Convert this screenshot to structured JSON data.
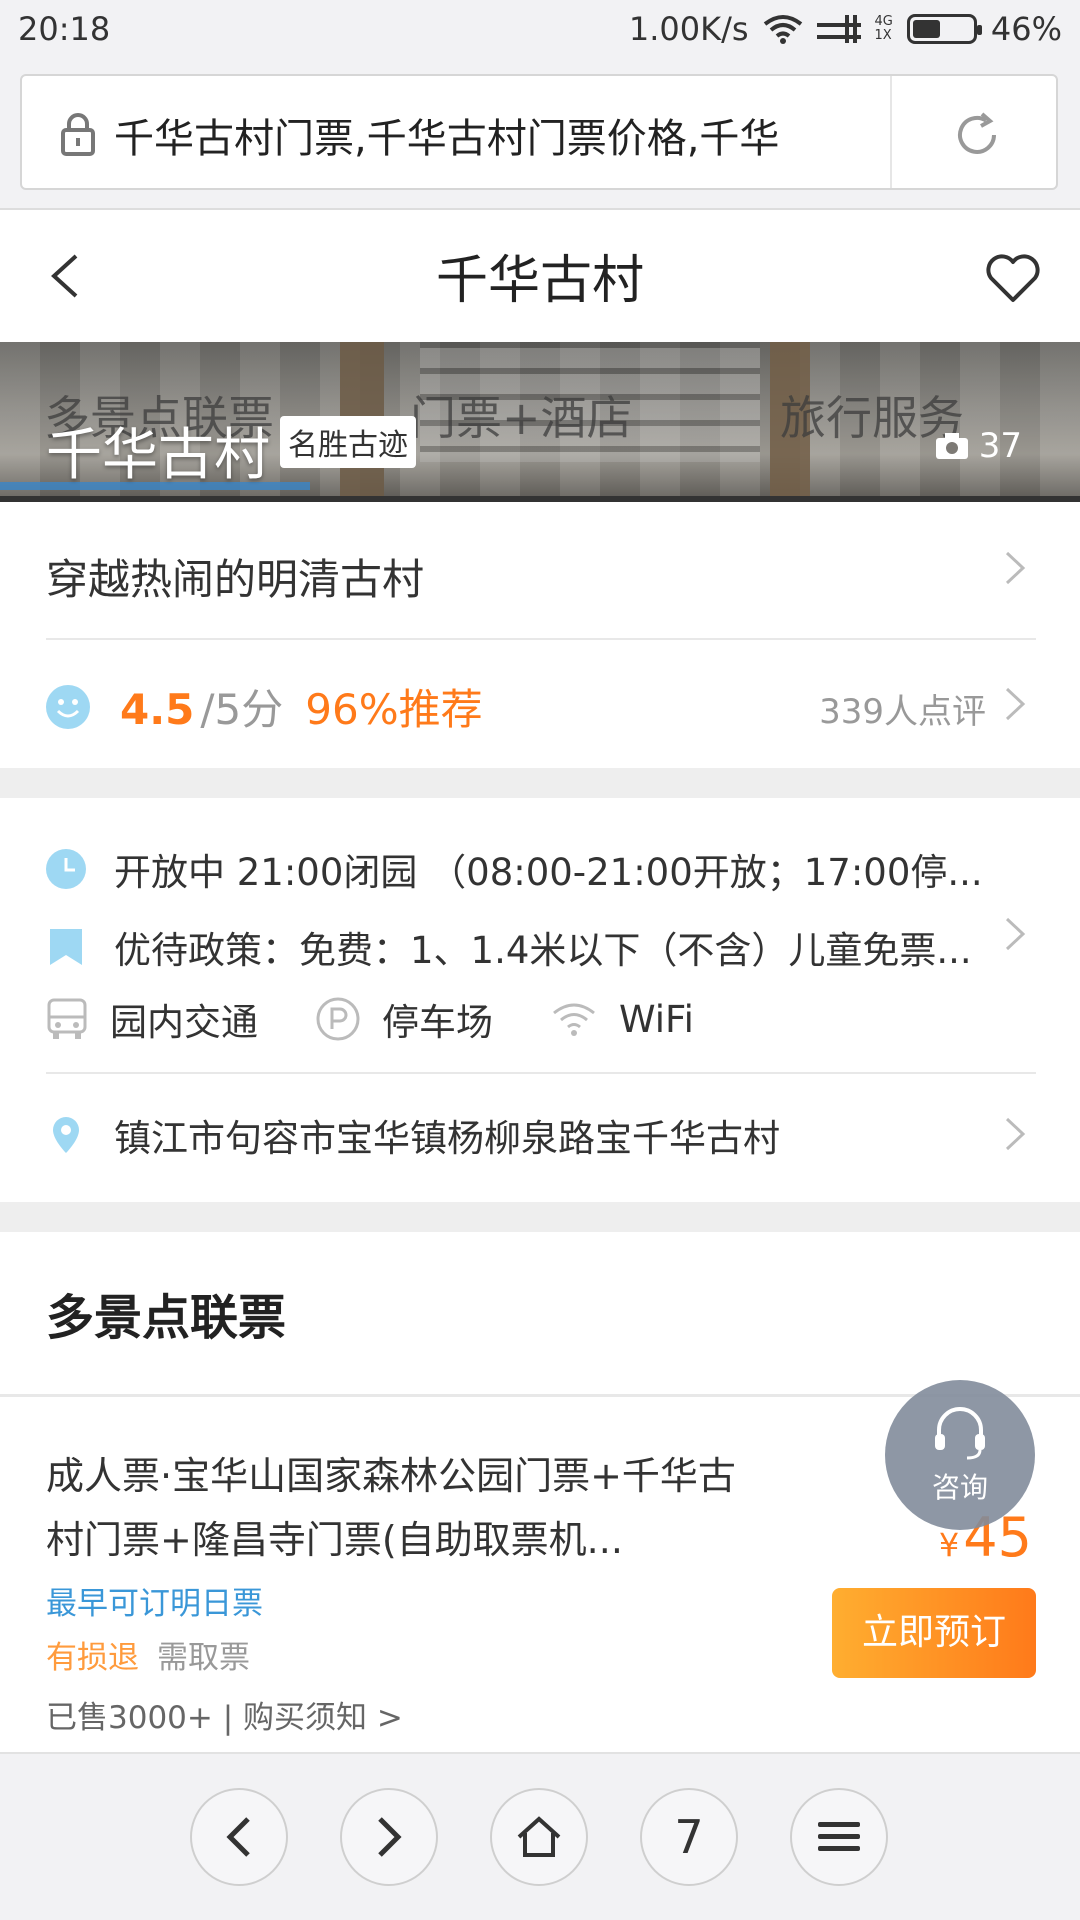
{
  "status_bar": {
    "time": "20:18",
    "speed": "1.00K/s",
    "net_top": "4G",
    "net_bottom": "1X",
    "battery": "46%",
    "battery_level": 0.46
  },
  "browser": {
    "url": "千华古村门票,千华古村门票价格,千华",
    "tab_count": "7"
  },
  "header": {
    "title": "千华古村"
  },
  "hero": {
    "tabs": [
      "多景点联票",
      "门票+酒店",
      "旅行服务"
    ],
    "name": "千华古村",
    "badge": "名胜古迹",
    "photo_count": "37"
  },
  "slogan": "穿越热闹的明清古村",
  "rating": {
    "score": "4.5",
    "out_of": "/5分",
    "recommend": "96%推荐",
    "reviews": "339人点评"
  },
  "info": {
    "hours": "开放中 21:00闭园 （08:00-21:00开放；17:00停...",
    "policy": "优待政策：免费：1、1.4米以下（不含）儿童免票...",
    "facilities": [
      "园内交通",
      "停车场",
      "WiFi"
    ],
    "address": "镇江市句容市宝华镇杨柳泉路宝千华古村"
  },
  "section_title": "多景点联票",
  "product": {
    "name": "成人票·宝华山国家森林公园门票+千华古村门票+隆昌寺门票(自助取票机...",
    "earliest": "最早可订明日票",
    "refund": "有损退",
    "pickup": "需取票",
    "sold": "已售3000+ | 购买须知 >",
    "currency": "¥",
    "price": "45",
    "book_label": "立即预订"
  },
  "consult_label": "咨询",
  "colors": {
    "accent_orange": "#ff7a1a",
    "link_blue": "#3a97d8",
    "icon_blue": "#9ed8f3"
  }
}
